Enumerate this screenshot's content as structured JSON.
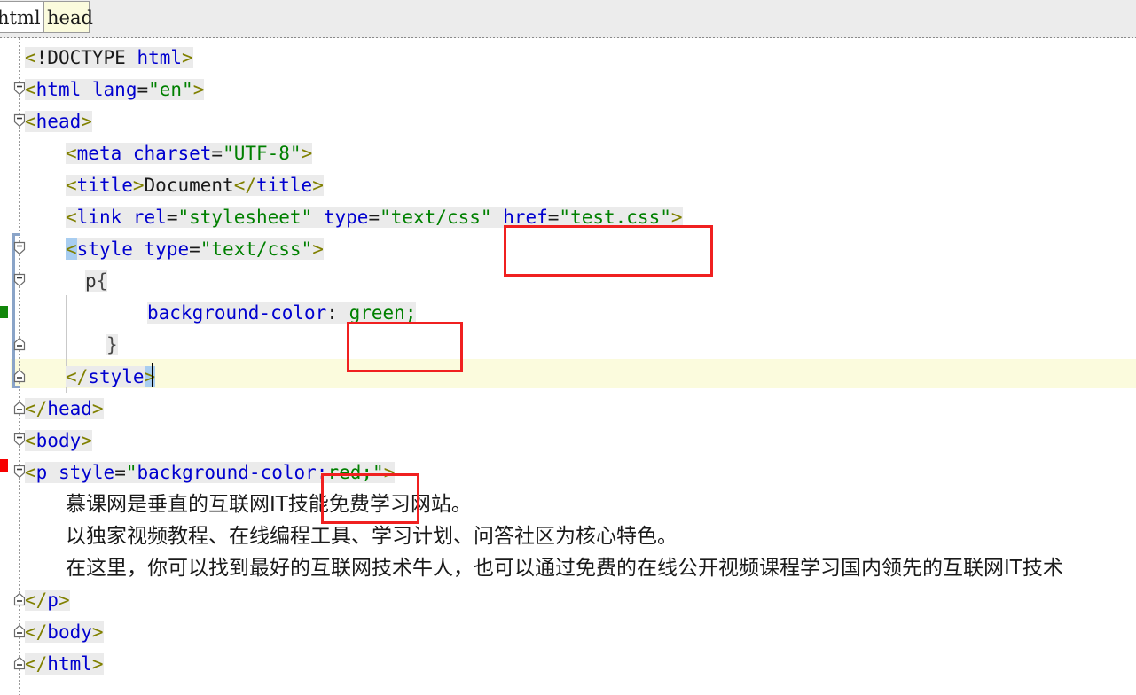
{
  "editor": {
    "language": "HTML",
    "theme_colors": {
      "background": "#ffffff",
      "code_highlight_background": "#ebebeb",
      "current_line": "#fbfbdd",
      "breadcrumb_background": "#ececec",
      "tag_bracket": "#808000",
      "tag_name": "#0000cf",
      "attribute_name": "#0000cf",
      "attribute_value": "#008000",
      "plain_text": "#1a1a1a",
      "matching_brace_highlight": "#a8cdf0",
      "scope_bar": "#8aa4c8",
      "annotation_box": "#f02020",
      "marker_added": "#12870a",
      "marker_modified": "#f70000"
    }
  },
  "breadcrumb": {
    "items": [
      {
        "label": "html",
        "selected": false
      },
      {
        "label": "head",
        "selected": true
      }
    ]
  },
  "code": {
    "lines": [
      {
        "n": 1,
        "tokens": [
          {
            "t": "<",
            "c": "br"
          },
          {
            "t": "!DOCTYPE ",
            "c": "txt"
          },
          {
            "t": "html",
            "c": "tag"
          },
          {
            "t": ">",
            "c": "br"
          }
        ]
      },
      {
        "n": 2,
        "tokens": [
          {
            "t": "<",
            "c": "br"
          },
          {
            "t": "html",
            "c": "tag"
          },
          {
            "t": " ",
            "c": "txt"
          },
          {
            "t": "lang",
            "c": "attr"
          },
          {
            "t": "=",
            "c": "txt"
          },
          {
            "t": "\"en\"",
            "c": "val"
          },
          {
            "t": ">",
            "c": "br"
          }
        ]
      },
      {
        "n": 3,
        "tokens": [
          {
            "t": "<",
            "c": "br"
          },
          {
            "t": "head",
            "c": "tag"
          },
          {
            "t": ">",
            "c": "br"
          }
        ]
      },
      {
        "n": 4,
        "tokens": [
          {
            "t": "<",
            "c": "br"
          },
          {
            "t": "meta",
            "c": "tag"
          },
          {
            "t": " ",
            "c": "txt"
          },
          {
            "t": "charset",
            "c": "attr"
          },
          {
            "t": "=",
            "c": "txt"
          },
          {
            "t": "\"UTF-8\"",
            "c": "val"
          },
          {
            "t": ">",
            "c": "br"
          }
        ]
      },
      {
        "n": 5,
        "tokens": [
          {
            "t": "<",
            "c": "br"
          },
          {
            "t": "title",
            "c": "tag"
          },
          {
            "t": ">",
            "c": "br"
          },
          {
            "t": "Document",
            "c": "txt"
          },
          {
            "t": "</",
            "c": "br"
          },
          {
            "t": "title",
            "c": "tag"
          },
          {
            "t": ">",
            "c": "br"
          }
        ]
      },
      {
        "n": 6,
        "tokens": [
          {
            "t": "<",
            "c": "br"
          },
          {
            "t": "link",
            "c": "tag"
          },
          {
            "t": " ",
            "c": "txt"
          },
          {
            "t": "rel",
            "c": "attr"
          },
          {
            "t": "=",
            "c": "txt"
          },
          {
            "t": "\"stylesheet\"",
            "c": "val"
          },
          {
            "t": " ",
            "c": "txt"
          },
          {
            "t": "type",
            "c": "attr"
          },
          {
            "t": "=",
            "c": "txt"
          },
          {
            "t": "\"text/css\"",
            "c": "val"
          },
          {
            "t": " ",
            "c": "txt"
          },
          {
            "t": "href",
            "c": "attr"
          },
          {
            "t": "=",
            "c": "txt"
          },
          {
            "t": "\"test.css\"",
            "c": "val"
          },
          {
            "t": ">",
            "c": "br"
          }
        ]
      },
      {
        "n": 7,
        "tokens": [
          {
            "t": "<",
            "c": "match-brace"
          },
          {
            "t": "style",
            "c": "tag"
          },
          {
            "t": " ",
            "c": "txt"
          },
          {
            "t": "type",
            "c": "attr"
          },
          {
            "t": "=",
            "c": "txt"
          },
          {
            "t": "\"text/css\"",
            "c": "val"
          },
          {
            "t": ">",
            "c": "br"
          }
        ]
      },
      {
        "n": 8,
        "tokens": [
          {
            "t": "p",
            "c": "sel"
          },
          {
            "t": "{",
            "c": "punc"
          }
        ]
      },
      {
        "n": 9,
        "tokens": [
          {
            "t": "background-color",
            "c": "prop"
          },
          {
            "t": ":",
            "c": "txt"
          },
          {
            "t": " ",
            "c": "txt"
          },
          {
            "t": "green",
            "c": "cval"
          },
          {
            "t": ";",
            "c": "cval"
          }
        ]
      },
      {
        "n": 10,
        "tokens": [
          {
            "t": "}",
            "c": "punc"
          }
        ]
      },
      {
        "n": 11,
        "tokens": [
          {
            "t": "</",
            "c": "br"
          },
          {
            "t": "style",
            "c": "tag"
          },
          {
            "t": ">",
            "c": "match-brace"
          }
        ]
      },
      {
        "n": 12,
        "tokens": [
          {
            "t": "</",
            "c": "br"
          },
          {
            "t": "head",
            "c": "tag"
          },
          {
            "t": ">",
            "c": "br"
          }
        ]
      },
      {
        "n": 13,
        "tokens": [
          {
            "t": "<",
            "c": "br"
          },
          {
            "t": "body",
            "c": "tag"
          },
          {
            "t": ">",
            "c": "br"
          }
        ]
      },
      {
        "n": 14,
        "tokens": [
          {
            "t": "<",
            "c": "br"
          },
          {
            "t": "p",
            "c": "tag"
          },
          {
            "t": " ",
            "c": "txt"
          },
          {
            "t": "style",
            "c": "attr"
          },
          {
            "t": "=",
            "c": "txt"
          },
          {
            "t": "\"",
            "c": "val"
          },
          {
            "t": "background-color",
            "c": "prop"
          },
          {
            "t": ":",
            "c": "attr"
          },
          {
            "t": "red",
            "c": "cval"
          },
          {
            "t": ";",
            "c": "cval"
          },
          {
            "t": "\"",
            "c": "val"
          },
          {
            "t": ">",
            "c": "br"
          }
        ]
      },
      {
        "n": 15,
        "text": "慕课网是垂直的互联网IT技能免费学习网站。",
        "kind": "cn"
      },
      {
        "n": 16,
        "text": "以独家视频教程、在线编程工具、学习计划、问答社区为核心特色。",
        "kind": "cn"
      },
      {
        "n": 17,
        "text": "在这里，你可以找到最好的互联网技术牛人，也可以通过免费的在线公开视频课程学习国内领先的互联网IT技术",
        "kind": "cn"
      },
      {
        "n": 18,
        "tokens": [
          {
            "t": "</",
            "c": "br"
          },
          {
            "t": "p",
            "c": "tag"
          },
          {
            "t": ">",
            "c": "br"
          }
        ]
      },
      {
        "n": 19,
        "tokens": [
          {
            "t": "</",
            "c": "br"
          },
          {
            "t": "body",
            "c": "tag"
          },
          {
            "t": ">",
            "c": "br"
          }
        ]
      },
      {
        "n": 20,
        "tokens": [
          {
            "t": "</",
            "c": "br"
          },
          {
            "t": "html",
            "c": "tag"
          },
          {
            "t": ">",
            "c": "br"
          }
        ]
      }
    ]
  },
  "annotations": [
    {
      "id": "annot-href",
      "target": "href=\"test.css\""
    },
    {
      "id": "annot-green",
      "target": "green;"
    },
    {
      "id": "annot-red",
      "target": ":red;\""
    }
  ]
}
